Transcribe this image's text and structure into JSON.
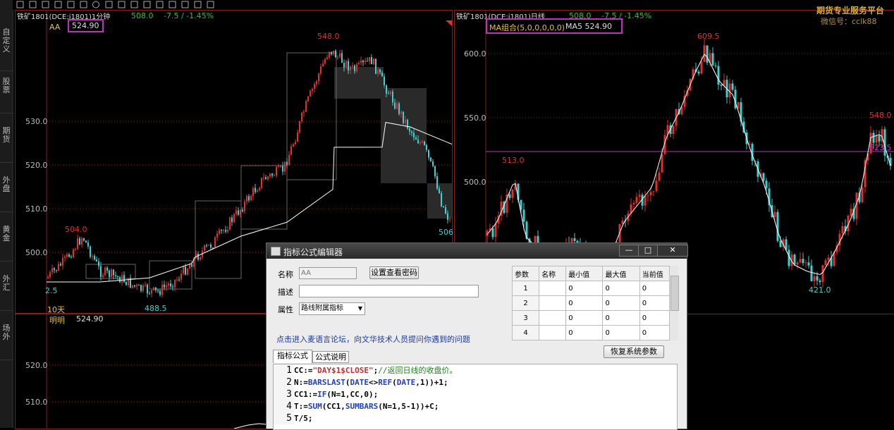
{
  "sidebar": {
    "items": [
      "自\n定\n义",
      "股\n票",
      "期\n货",
      "外\n盘",
      "黄\n金",
      "外\n汇",
      "场\n外"
    ]
  },
  "left_chart": {
    "title": "铁矿1801(DCE:i1801)1分钟",
    "price": "508.0",
    "change": "-7.5 / -1.45%",
    "indicator_name": "AA",
    "indicator_value": "524.90",
    "y_ticks": [
      "530.0",
      "520.0",
      "510.0",
      "500.0"
    ],
    "high_label": "548.0",
    "low_label": "488.5",
    "label_504": "504.0",
    "label_left": "2.5",
    "label_right": "506",
    "period_label": "10天",
    "lower_pane": {
      "name": "明明",
      "value": "524.90",
      "y_ticks": [
        "520.0",
        "510.0"
      ]
    }
  },
  "right_chart": {
    "title": "铁矿1801(DCE:i1801)日线",
    "price": "508.0",
    "change": "-7.5 / -1.45%",
    "ma_label": "MA组合(5,0,0,0,0,0)",
    "ma5_label": "MA5 524.90",
    "y_ticks": [
      "600.0",
      "550.0",
      "500.0"
    ],
    "high_label": "609.5",
    "low_label": "421.0",
    "label_513": "513.0",
    "label_548": "548.0",
    "label_523": "523.5"
  },
  "watermark": {
    "line1": "期货专业服务平台",
    "line2": "微信号：cclk88"
  },
  "dialog": {
    "title": "指标公式编辑器",
    "name_label": "名称",
    "name_value": "AA",
    "password_button": "设置查看密码",
    "desc_label": "描述",
    "attr_label": "属性",
    "attr_value": "路线附属指标",
    "forum_link": "点击进入麦语言论坛，向文华技术人员提问你遇到的问题",
    "reset_button": "恢复系统参数",
    "tabs": [
      "指标公式",
      "公式说明"
    ],
    "params": {
      "headers": [
        "参数",
        "名称",
        "最小值",
        "最大值",
        "当前值"
      ],
      "rows": [
        [
          "1",
          "",
          "0",
          "0",
          "0"
        ],
        [
          "2",
          "",
          "0",
          "0",
          "0"
        ],
        [
          "3",
          "",
          "0",
          "0",
          "0"
        ],
        [
          "4",
          "",
          "0",
          "0",
          "0"
        ]
      ]
    },
    "code_lines": [
      "CC:=\"DAY$1$CLOSE\";//返回日线的收盘价。",
      "N:=BARSLAST(DATE<>REF(DATE,1))+1;",
      "CC1:=IF(N=1,CC,0);",
      "T:=SUM(CC1,SUMBARS(N=1,5-1))+C;",
      "T/5;"
    ],
    "line_numbers": [
      "1",
      "2",
      "3",
      "4",
      "5"
    ]
  },
  "colors": {
    "up": "#e03030",
    "down": "#40d0d0",
    "ma_line": "#ffffff",
    "magenta": "#c030c0",
    "grid_red": "#8b1a1a",
    "green_text": "#30c030"
  }
}
